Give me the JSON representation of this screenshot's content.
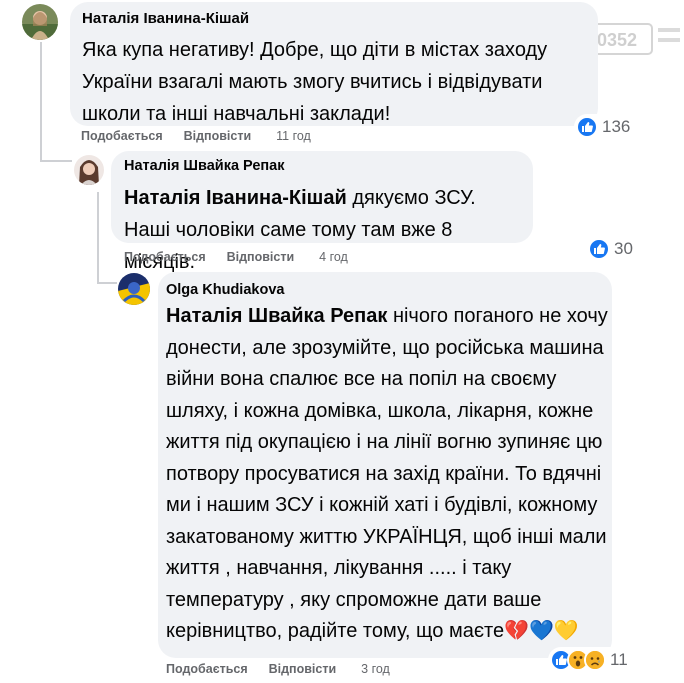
{
  "watermark": {
    "text": "0352"
  },
  "comments": [
    {
      "author": "Наталія Іванина-Кішай",
      "mention": "",
      "text": "Яка купа негативу! Добре, що діти в містах заходу України взагалі мають змогу вчитись і відвідувати школи та інші навчальні заклади!",
      "like_label": "Подобається",
      "reply_label": "Відповісти",
      "time": "11 год",
      "reaction_count": "136",
      "reactions": [
        "like-icon"
      ]
    },
    {
      "author": "Наталія Швайка Репак",
      "mention": "Наталія Іванина-Кішай",
      "text": " дякуємо ЗСУ. Наші чоловіки саме тому там вже 8 місяців.",
      "like_label": "Подобається",
      "reply_label": "Відповісти",
      "time": "4 год",
      "reaction_count": "30",
      "reactions": [
        "like-icon"
      ]
    },
    {
      "author": "Olga Khudiakova",
      "mention": "Наталія Швайка Репак",
      "text": " нічого поганого не хочу донести, але зрозумійте, що російська машина війни вона спалює все на попіл на своєму шляху, і кожна домівка, школа, лікарня, кожне життя під окупацією і на лінії вогню зупиняє цю потвору просуватися на захід країни. То вдячні ми і нашим ЗСУ і кожній хаті і будівлі, кожному закатованому життю УКРАЇНЦЯ, щоб інші мали життя , навчання, лікування ..... і таку температуру , яку спроможне дати ваше керівництво, радійте тому, що маєте💔💙💛",
      "like_label": "Подобається",
      "reply_label": "Відповісти",
      "time": "3 год",
      "reaction_count": "11",
      "reactions": [
        "like-icon",
        "wow-icon",
        "sad-icon"
      ]
    }
  ],
  "colors": {
    "bubble": "#f0f2f5",
    "meta": "#65676b",
    "like": "#1877f2",
    "thread": "#ced0d4"
  }
}
